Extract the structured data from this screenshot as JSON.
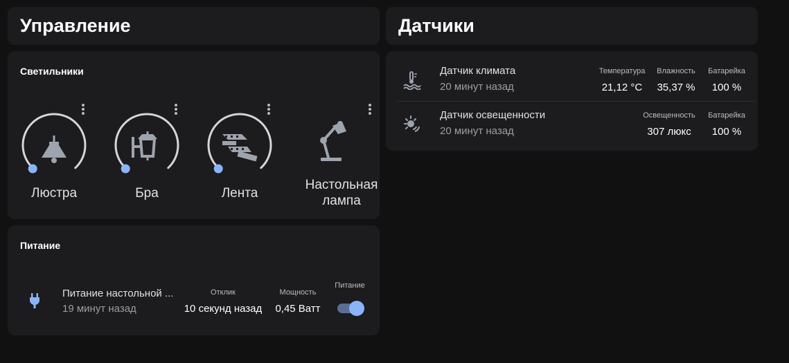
{
  "management": {
    "title": "Управление"
  },
  "sensors_title": "Датчики",
  "lights": {
    "title": "Светильники",
    "items": [
      {
        "label": "Люстра",
        "icon": "ceiling-lamp-icon"
      },
      {
        "label": "Бра",
        "icon": "wall-lamp-icon"
      },
      {
        "label": "Лента",
        "icon": "led-strip-icon"
      },
      {
        "label": "Настольная лампа",
        "icon": "desk-lamp-icon"
      }
    ]
  },
  "power": {
    "title": "Питание",
    "entity": {
      "name": "Питание настольной ...",
      "last_changed": "19 минут назад",
      "attrs": [
        {
          "label": "Отклик",
          "value": "10 секунд назад"
        },
        {
          "label": "Мощность",
          "value": "0,45 Ватт"
        }
      ],
      "switch_label": "Питание",
      "switch_on": true
    }
  },
  "sensors": [
    {
      "name": "Датчик климата",
      "last_changed": "20 минут назад",
      "icon": "thermometer-water-icon",
      "attrs": [
        {
          "label": "Температура",
          "value": "21,12 °C"
        },
        {
          "label": "Влажность",
          "value": "35,37 %"
        },
        {
          "label": "Батарейка",
          "value": "100 %"
        }
      ]
    },
    {
      "name": "Датчик освещенности",
      "last_changed": "20 минут назад",
      "icon": "brightness-sensor-icon",
      "attrs": [
        {
          "label": "Освещенность",
          "value": "307 люкс"
        },
        {
          "label": "Батарейка",
          "value": "100 %"
        }
      ]
    }
  ],
  "colors": {
    "background": "#111111",
    "card": "#1c1c1e",
    "accent": "#8ab4f8",
    "ring": "#d6d6d6",
    "icon": "#9ea4ad"
  }
}
